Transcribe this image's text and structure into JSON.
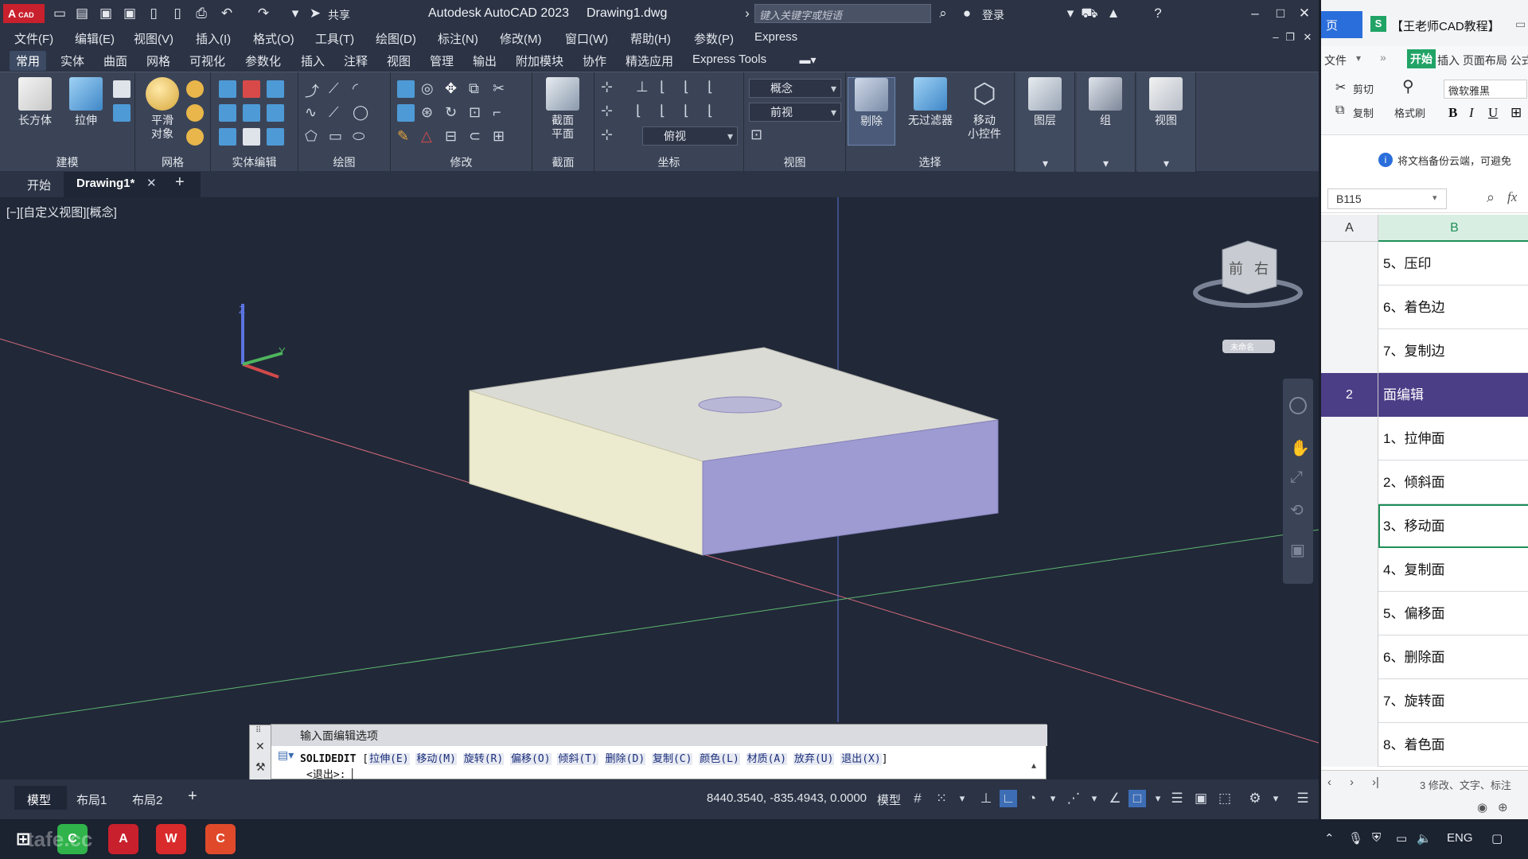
{
  "titlebar": {
    "logo": "A",
    "logo_sub": "CAD",
    "share": "共享",
    "title": "Autodesk AutoCAD 2023",
    "filename": "Drawing1.dwg",
    "search_placeholder": "键入关键字或短语",
    "login": "登录"
  },
  "menubar": [
    "文件(F)",
    "编辑(E)",
    "视图(V)",
    "插入(I)",
    "格式(O)",
    "工具(T)",
    "绘图(D)",
    "标注(N)",
    "修改(M)",
    "窗口(W)",
    "帮助(H)",
    "参数(P)",
    "Express"
  ],
  "ribbon_tabs": [
    "常用",
    "实体",
    "曲面",
    "网格",
    "可视化",
    "参数化",
    "插入",
    "注释",
    "视图",
    "管理",
    "输出",
    "附加模块",
    "协作",
    "精选应用",
    "Express Tools"
  ],
  "ribbon": {
    "box": "长方体",
    "extrude": "拉伸",
    "smooth": "平滑",
    "smooth2": "对象",
    "section": "截面",
    "section2": "平面",
    "cull": "剔除",
    "nofilter": "无过滤器",
    "gizmo": "移动",
    "gizmo2": "小控件",
    "layers": "图层",
    "group": "组",
    "view": "视图",
    "visual_style": "概念",
    "view_front": "前视",
    "view_top": "俯视",
    "panels": [
      "建模",
      "网格",
      "实体编辑",
      "绘图",
      "修改",
      "截面",
      "坐标",
      "视图",
      "选择"
    ]
  },
  "doctabs": {
    "start": "开始",
    "drawing": "Drawing1*"
  },
  "viewport": {
    "label": "[−][自定义视图][概念]",
    "viewcube_front": "前",
    "viewcube_right": "右",
    "viewcube_wcs": "未命名"
  },
  "command": {
    "header": "输入面编辑选项",
    "cmd": "SOLIDEDIT",
    "options": [
      "拉伸(E)",
      "移动(M)",
      "旋转(R)",
      "偏移(O)",
      "倾斜(T)",
      "删除(D)",
      "复制(C)",
      "颜色(L)",
      "材质(A)",
      "放弃(U)",
      "退出(X)"
    ],
    "prompt": "<退出>:"
  },
  "statusbar": {
    "model_tab": "模型",
    "layout1": "布局1",
    "layout2": "布局2",
    "coords": "8440.3540, -835.4943, 0.0000",
    "model": "模型"
  },
  "wps": {
    "page_tab": "页",
    "doc_title": "【王老师CAD教程】",
    "file_menu": "文件",
    "start": "开始",
    "insert": "插入 页面布局 公式",
    "cut": "剪切",
    "copy": "复制",
    "format_painter": "格式刷",
    "font": "微软雅黑",
    "info": "将文档备份云端，可避免",
    "namebox": "B115",
    "col_a": "A",
    "col_b": "B",
    "rows": [
      {
        "rn": "",
        "text": "5、压印"
      },
      {
        "rn": "",
        "text": "6、着色边"
      },
      {
        "rn": "",
        "text": "7、复制边"
      },
      {
        "rn": "2",
        "text": "面编辑"
      },
      {
        "rn": "",
        "text": "1、拉伸面"
      },
      {
        "rn": "",
        "text": "2、倾斜面"
      },
      {
        "rn": "",
        "text": "3、移动面"
      },
      {
        "rn": "",
        "text": "4、复制面"
      },
      {
        "rn": "",
        "text": "5、偏移面"
      },
      {
        "rn": "",
        "text": "6、删除面"
      },
      {
        "rn": "",
        "text": "7、旋转面"
      },
      {
        "rn": "",
        "text": "8、着色面"
      }
    ],
    "sheet_info": "3 修改、文字、标注"
  },
  "taskbar": {
    "lang": "ENG",
    "watermark": "tafe.cc"
  }
}
